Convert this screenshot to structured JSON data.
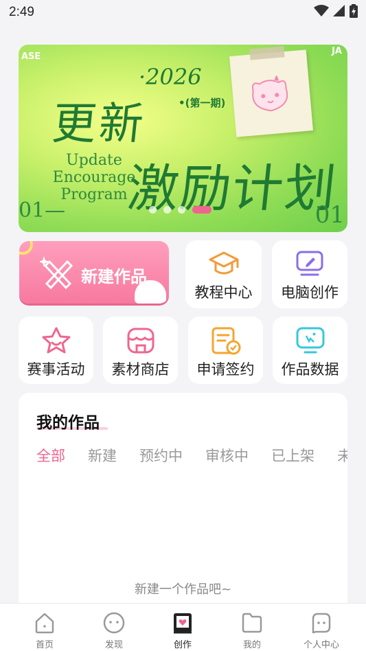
{
  "status_bar": {
    "time": "2:49",
    "icons": [
      "wifi-icon",
      "signal-icon",
      "battery-icon"
    ]
  },
  "banner": {
    "title_cn_1": "更新",
    "title_cn_2": "激励计划",
    "year": "·2026",
    "issue": "•(第一期)",
    "subtitle_en": "Update Encourage Program",
    "corner_left": "01—",
    "corner_right": "01",
    "corner_top_left": "ASE",
    "corner_top_right": "JA",
    "carousel_active_index": 3,
    "carousel_count": 4
  },
  "quick_actions": {
    "new_work": "新建作品",
    "tutorial_center": "教程中心",
    "pc_creation": "电脑创作",
    "events": "赛事活动",
    "material_store": "素材商店",
    "apply_contract": "申请签约",
    "work_data": "作品数据"
  },
  "my_works": {
    "title": "我的作品",
    "tabs": [
      "全部",
      "新建",
      "预约中",
      "审核中",
      "已上架",
      "未"
    ],
    "active_tab": "全部",
    "empty_text": "新建一个作品吧~"
  },
  "bottom_nav": {
    "items": [
      {
        "label": "首页",
        "icon": "home-icon"
      },
      {
        "label": "发现",
        "icon": "discover-icon"
      },
      {
        "label": "创作",
        "icon": "create-icon"
      },
      {
        "label": "我的",
        "icon": "folder-icon"
      },
      {
        "label": "个人中心",
        "icon": "profile-icon"
      }
    ],
    "active": "创作"
  },
  "colors": {
    "accent": "#f0658f",
    "background": "#f4f4f7",
    "banner_green": "#1f7a33"
  }
}
